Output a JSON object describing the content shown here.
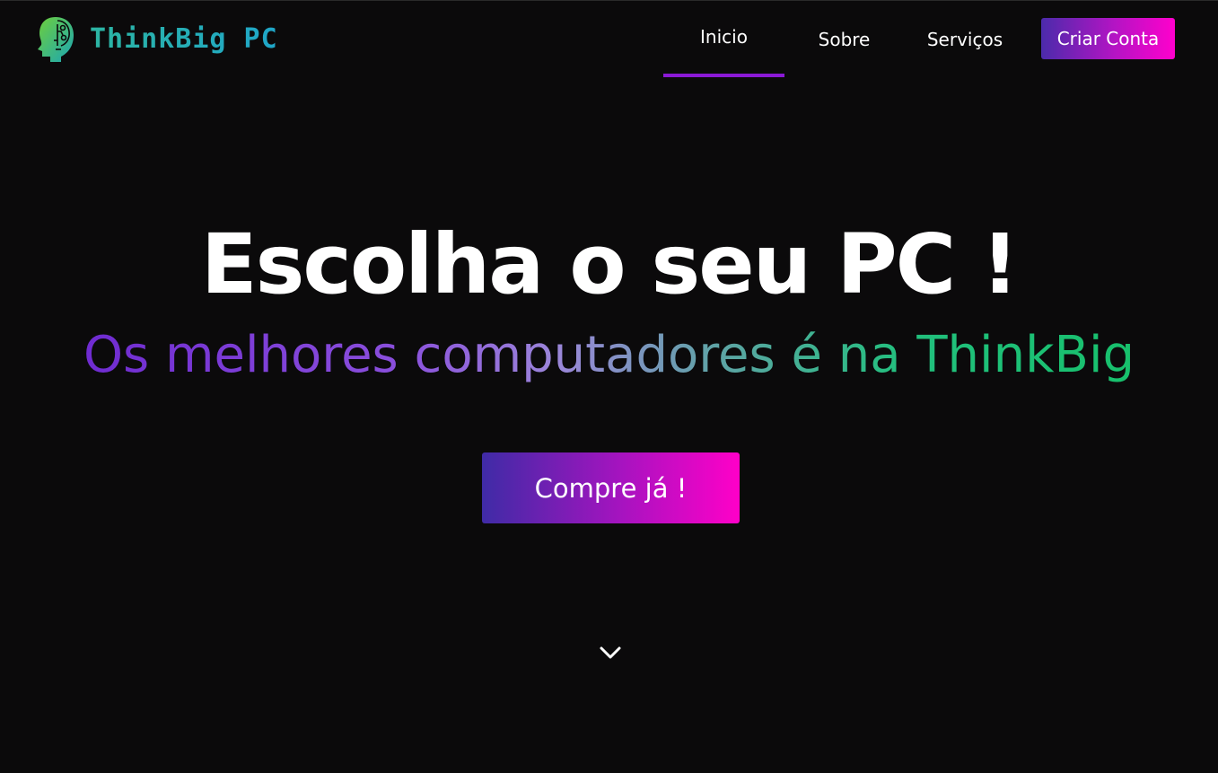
{
  "header": {
    "brand": "ThinkBig PC",
    "logo_icon": "brain-head-lightbulb-icon",
    "nav": [
      {
        "label": "Inicio",
        "active": true
      },
      {
        "label": "Sobre",
        "active": false
      },
      {
        "label": "Serviços",
        "active": false
      }
    ],
    "cta_label": "Criar Conta"
  },
  "hero": {
    "title": "Escolha o seu PC !",
    "subtitle": "Os melhores computadores é na ThinkBig",
    "button_label": "Compre já !",
    "scroll_icon": "chevron-down-icon"
  },
  "colors": {
    "background": "#0b0a0b",
    "active_underline": "#8b19d6",
    "gradient_start": "#3f2ba6",
    "gradient_end": "#ff00c8",
    "subtitle_start": "#6f2bd1",
    "subtitle_end": "#17c06c"
  }
}
